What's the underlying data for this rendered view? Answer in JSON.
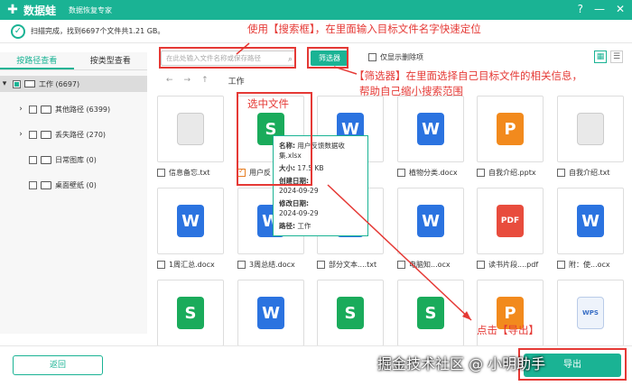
{
  "app": {
    "name": "数据蛙",
    "subtitle": "数据恢复专家",
    "scan_info": "扫描完成，找到6697个文件共1.21 GB。"
  },
  "window": {
    "help": "?",
    "minimize": "—",
    "close": "✕"
  },
  "sidebar": {
    "tabs": [
      "按路径查看",
      "按类型查看"
    ],
    "items": [
      {
        "label": "工作 (6697)"
      },
      {
        "label": "其他路径 (6399)"
      },
      {
        "label": "丢失路径 (270)"
      },
      {
        "label": "日常图库 (0)"
      },
      {
        "label": "桌面壁纸 (0)"
      }
    ]
  },
  "toolbar": {
    "search_placeholder": "在此处输入文件名称或保存路径",
    "filter": "筛选器",
    "show_deleted": "仅显示删除项"
  },
  "nav": {
    "back": "←",
    "forward": "→",
    "up": "↑",
    "path": "工作"
  },
  "files": [
    {
      "name": "信息备忘.txt",
      "type": "txt"
    },
    {
      "name": "用户反",
      "type": "s"
    },
    {
      "name": "ocx",
      "type": "w"
    },
    {
      "name": "植物分类.docx",
      "type": "w"
    },
    {
      "name": "自我介绍.pptx",
      "type": "p"
    },
    {
      "name": "自我介绍.txt",
      "type": "txt"
    },
    {
      "name": "1周汇总.docx",
      "type": "w"
    },
    {
      "name": "3周总结.docx",
      "type": "w"
    },
    {
      "name": "部分文本....txt",
      "type": "w"
    },
    {
      "name": "电脑知...ocx",
      "type": "w"
    },
    {
      "name": "读书片段....pdf",
      "type": "pdf"
    },
    {
      "name": "附：使...ocx",
      "type": "w"
    },
    {
      "name": "",
      "type": "s"
    },
    {
      "name": "",
      "type": "w"
    },
    {
      "name": "",
      "type": "s"
    },
    {
      "name": "",
      "type": "s"
    },
    {
      "name": "",
      "type": "p"
    },
    {
      "name": "",
      "type": "wps"
    }
  ],
  "tooltip": {
    "name_label": "名称:",
    "name": "用户反馈数据收集.xlsx",
    "size_label": "大小:",
    "size": "17.5 KB",
    "created_label": "创建日期:",
    "created": "2024-09-29",
    "modified_label": "修改日期:",
    "modified": "2024-09-29",
    "path_label": "路径:",
    "path": "工作"
  },
  "annotations": {
    "search": "使用【搜索框】，在里面输入目标文件名字快速定位",
    "filter_1": "【筛选器】在里面选择自己目标文件的相关信息，",
    "filter_2": "帮助自己缩小搜索范围",
    "select": "选中文件",
    "export": "点击【导出】"
  },
  "footer": {
    "back": "返回",
    "export": "导出"
  },
  "watermark": "掘金技术社区 @ 小明助手"
}
